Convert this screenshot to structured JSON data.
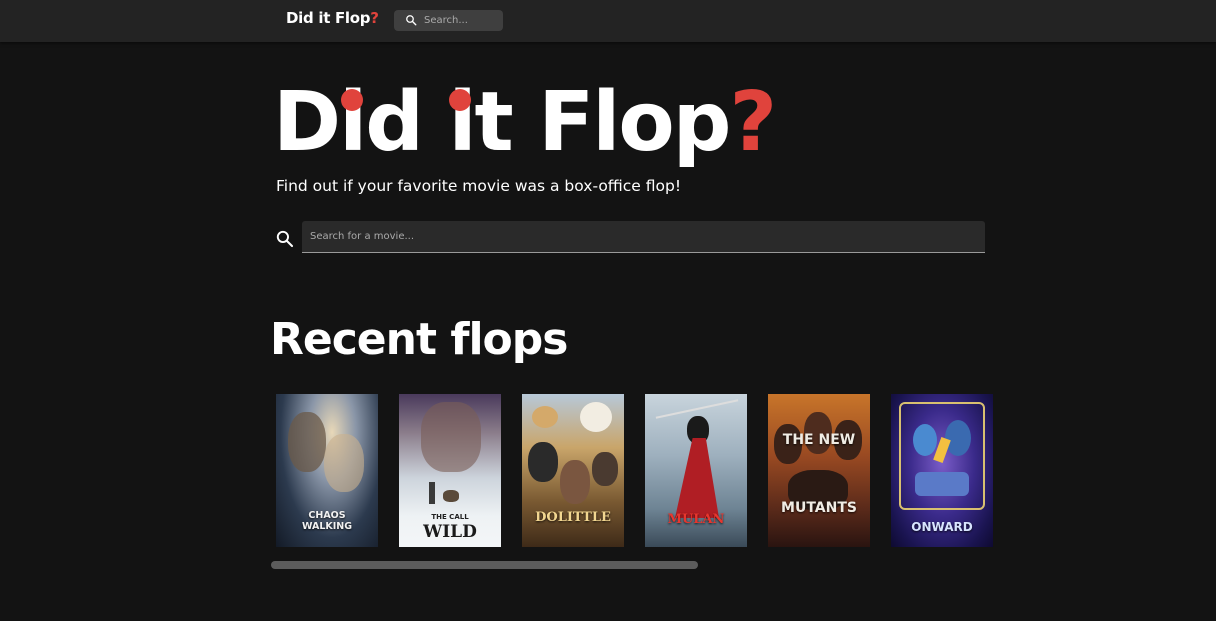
{
  "navbar": {
    "logo_prefix": "Did it Flop",
    "logo_suffix": "?",
    "search_placeholder": "Search..."
  },
  "hero": {
    "title_part1": "D",
    "title_dot1": "i",
    "title_part2": "d ",
    "title_dot2": "i",
    "title_part3": "t Flop",
    "title_qmark": "?",
    "subtitle": "Find out if your favorite movie was a box-office flop!",
    "search_placeholder": "Search for a movie..."
  },
  "recent": {
    "heading": "Recent flops",
    "movies": [
      {
        "title_line1": "CHAOS",
        "title_line2": "WALKING"
      },
      {
        "title_line1": "THE CALL",
        "title_line2": "WILD"
      },
      {
        "title_line1": "DOLITTLE",
        "title_line2": ""
      },
      {
        "title_line1": "MULAN",
        "title_line2": ""
      },
      {
        "title_line1": "THE NEW",
        "title_line2": "MUTANTS"
      },
      {
        "title_line1": "ONWARD",
        "title_line2": ""
      }
    ]
  },
  "colors": {
    "accent": "#e0433c",
    "background": "#131313",
    "navbar": "#232323"
  }
}
